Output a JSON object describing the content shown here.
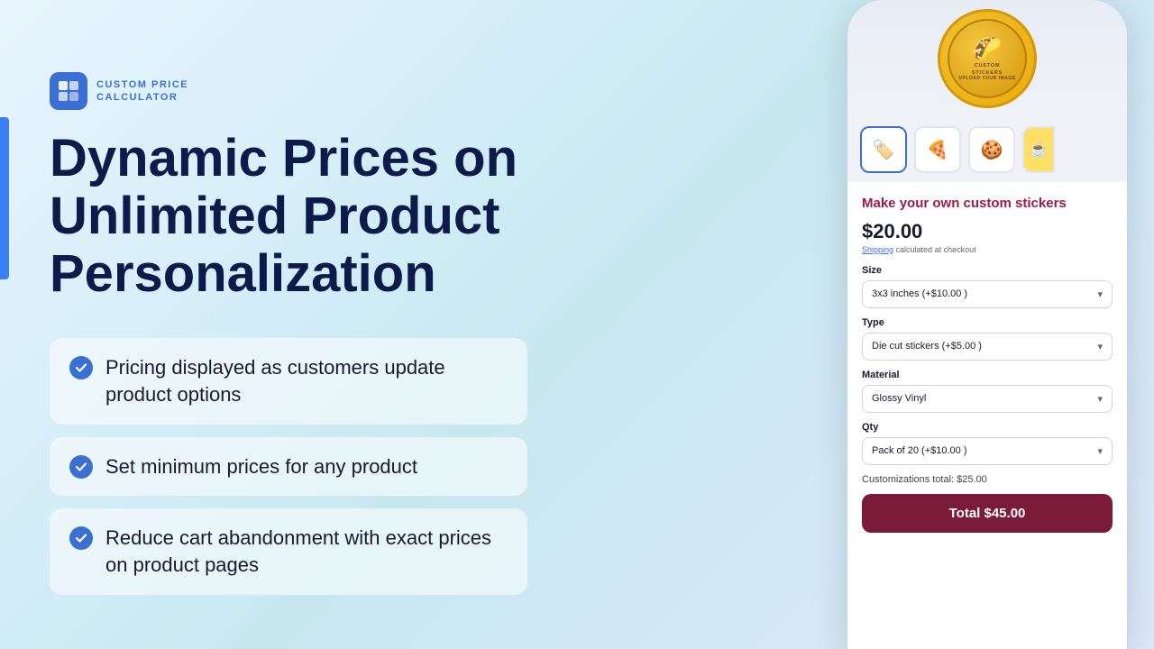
{
  "app": {
    "logo_line1": "CUSTOM PRICE",
    "logo_line2": "CALCULATOR"
  },
  "heading": {
    "line1": "Dynamic Prices on",
    "line2": "Unlimited Product",
    "line3": "Personalization"
  },
  "features": [
    {
      "id": "feature-1",
      "text": "Pricing displayed as customers update product options"
    },
    {
      "id": "feature-2",
      "text": "Set minimum prices for any product"
    },
    {
      "id": "feature-3",
      "text": "Reduce cart abandonment with exact prices on product pages"
    }
  ],
  "product": {
    "name": "Make your own custom stickers",
    "price": "$20.00",
    "shipping_note": "Shipping",
    "shipping_suffix": " calculated at checkout",
    "size_label": "Size",
    "size_value": "3x3 inches (+$10.00 )",
    "type_label": "Type",
    "type_value": "Die cut stickers (+$5.00 )",
    "material_label": "Material",
    "material_value": "Glossy Vinyl",
    "qty_label": "Qty",
    "qty_value": "Pack of 20 (+$10.00 )",
    "customizations_total": "Customizations total: $25.00",
    "total_button": "Total $45.00"
  },
  "thumbnails": [
    {
      "emoji": "🏷️",
      "active": true
    },
    {
      "emoji": "🍕",
      "active": false
    },
    {
      "emoji": "🍪",
      "active": false
    }
  ],
  "colors": {
    "accent_blue": "#3b6fd4",
    "heading_dark": "#0d1b4b",
    "product_name_color": "#9b1b4b",
    "total_button_bg": "#7b1b3a"
  }
}
